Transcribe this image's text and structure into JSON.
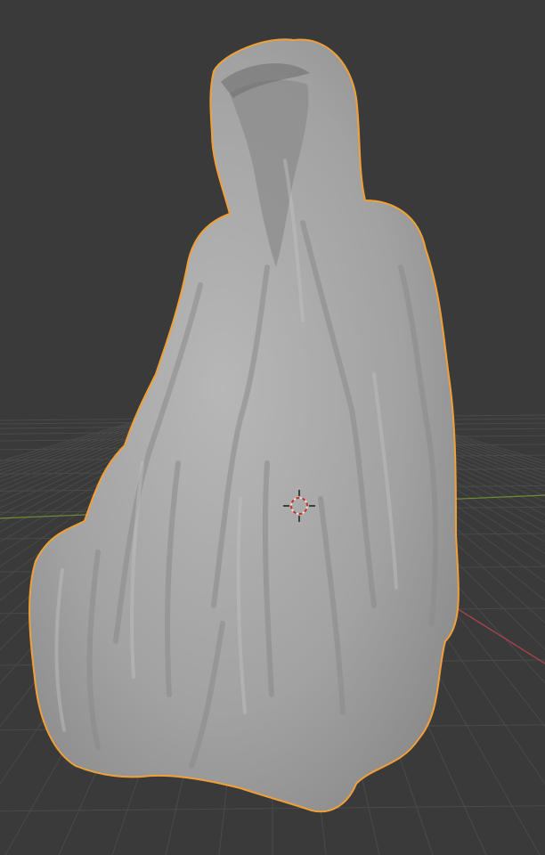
{
  "app": "Blender",
  "viewport": {
    "mode": "3d-viewport-solid",
    "background_color": "#3a3a3a",
    "grid_color": "#4a4a4a",
    "x_axis_color": "#b5424d",
    "y_axis_color": "#6d8f32",
    "selection_outline_color": "#f2a036",
    "mesh_color": "#a7a7a7",
    "selected_object": "hooded-figure-sculpt",
    "cursor_icon": "3d-cursor-icon"
  }
}
